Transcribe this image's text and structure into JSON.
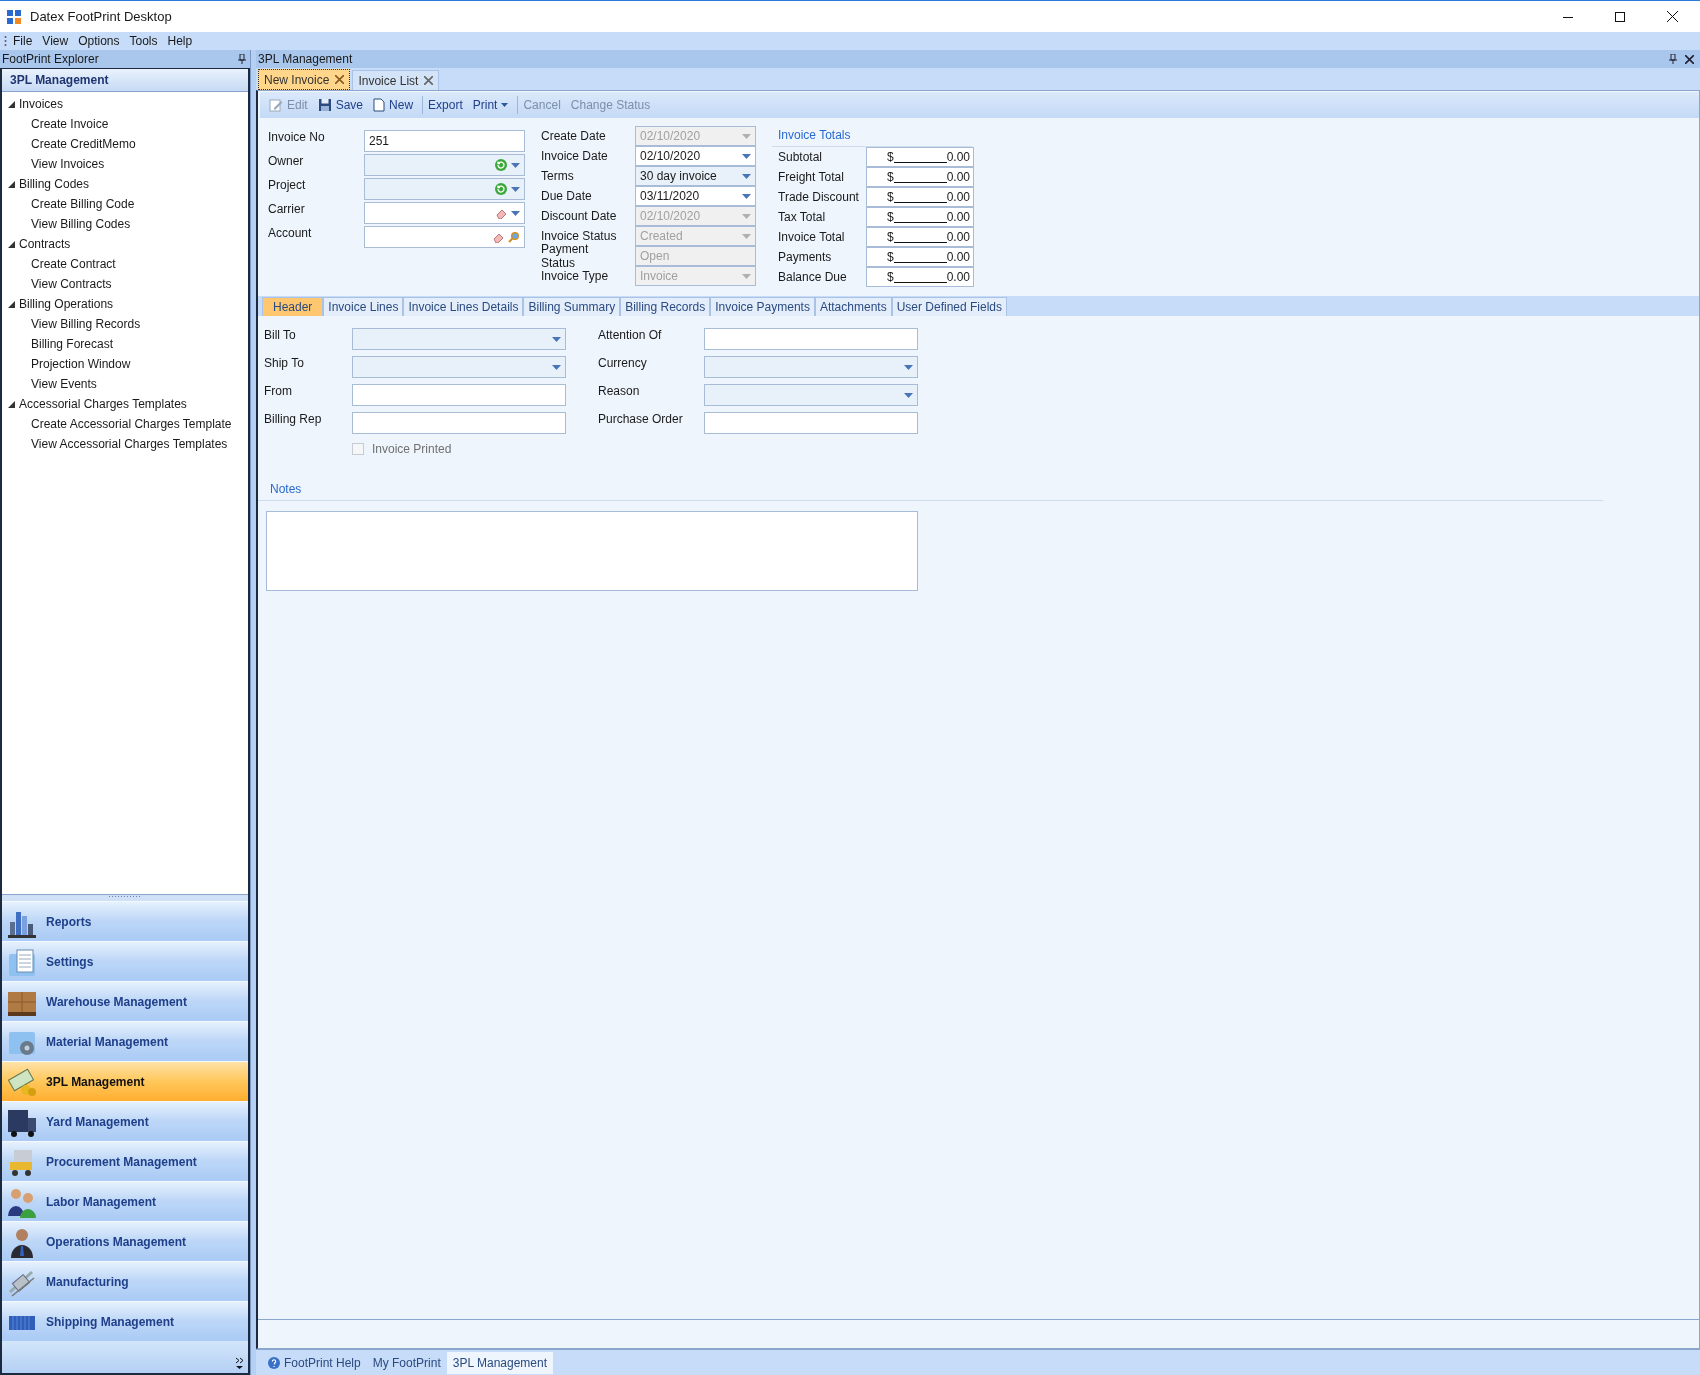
{
  "window": {
    "title": "Datex FootPrint Desktop"
  },
  "menu": [
    "File",
    "View",
    "Options",
    "Tools",
    "Help"
  ],
  "explorer": {
    "title": "FootPrint Explorer",
    "section": "3PL Management",
    "tree": [
      {
        "label": "Invoices",
        "expanded": true,
        "children": [
          {
            "label": "Create Invoice"
          },
          {
            "label": "Create CreditMemo"
          },
          {
            "label": "View Invoices"
          }
        ]
      },
      {
        "label": "Billing Codes",
        "expanded": true,
        "children": [
          {
            "label": "Create Billing Code"
          },
          {
            "label": "View Billing Codes"
          }
        ]
      },
      {
        "label": "Contracts",
        "expanded": true,
        "children": [
          {
            "label": "Create Contract"
          },
          {
            "label": "View Contracts"
          }
        ]
      },
      {
        "label": "Billing Operations",
        "expanded": true,
        "children": [
          {
            "label": "View Billing Records"
          },
          {
            "label": "Billing Forecast"
          },
          {
            "label": "Projection Window"
          },
          {
            "label": "View Events"
          }
        ]
      },
      {
        "label": "Accessorial Charges Templates",
        "expanded": true,
        "children": [
          {
            "label": "Create Accessorial Charges Template"
          },
          {
            "label": "View Accessorial Charges Templates"
          }
        ]
      }
    ],
    "modules": [
      {
        "label": "Reports",
        "kind": "chart",
        "selected": false
      },
      {
        "label": "Settings",
        "kind": "folder-doc",
        "selected": false
      },
      {
        "label": "Warehouse Management",
        "kind": "boxes",
        "selected": false
      },
      {
        "label": "Material Management",
        "kind": "folder-gear",
        "selected": false
      },
      {
        "label": "3PL Management",
        "kind": "money",
        "selected": true
      },
      {
        "label": "Yard Management",
        "kind": "truck",
        "selected": false
      },
      {
        "label": "Procurement Management",
        "kind": "cart",
        "selected": false
      },
      {
        "label": "Labor Management",
        "kind": "people",
        "selected": false
      },
      {
        "label": "Operations Management",
        "kind": "person",
        "selected": false
      },
      {
        "label": "Manufacturing",
        "kind": "machine",
        "selected": false
      },
      {
        "label": "Shipping Management",
        "kind": "container",
        "selected": false
      }
    ]
  },
  "workspace": {
    "title": "3PL Management",
    "doc_tabs": [
      {
        "label": "New Invoice",
        "selected": true
      },
      {
        "label": "Invoice List",
        "selected": false
      }
    ],
    "toolbar": [
      [
        {
          "label": "Edit",
          "kind": "edit",
          "disabled": true
        },
        {
          "label": "Save",
          "kind": "save",
          "disabled": false
        },
        {
          "label": "New",
          "kind": "new",
          "disabled": false
        }
      ],
      [
        {
          "label": "Export",
          "kind": "plain",
          "disabled": false
        },
        {
          "label": "Print",
          "kind": "menu",
          "disabled": false
        }
      ],
      [
        {
          "label": "Cancel",
          "kind": "plain",
          "disabled": true
        },
        {
          "label": "Change Status",
          "kind": "plain",
          "disabled": true
        }
      ]
    ],
    "fields_left": [
      {
        "label": "Invoice No",
        "kind": "text",
        "value": "251",
        "disabled": false
      },
      {
        "label": "Owner",
        "kind": "refresh-combo",
        "disabled": false
      },
      {
        "label": "Project",
        "kind": "refresh-combo",
        "disabled": false
      },
      {
        "label": "Carrier",
        "kind": "clear-combo",
        "disabled": false
      },
      {
        "label": "Account",
        "kind": "clear-search",
        "disabled": false
      }
    ],
    "fields_mid": [
      {
        "label": "Create Date",
        "kind": "date",
        "value": "02/10/2020",
        "disabled": true
      },
      {
        "label": "Invoice Date",
        "kind": "date",
        "value": "02/10/2020",
        "disabled": false
      },
      {
        "label": "Terms",
        "kind": "combo",
        "value": "30 day invoice",
        "disabled": false
      },
      {
        "label": "Due Date",
        "kind": "date",
        "value": "03/11/2020",
        "disabled": false
      },
      {
        "label": "Discount Date",
        "kind": "date",
        "value": "02/10/2020",
        "disabled": true
      },
      {
        "label": "Invoice Status",
        "kind": "combo",
        "value": "Created",
        "disabled": true
      },
      {
        "label": "Payment Status",
        "kind": "text",
        "value": "Open",
        "disabled": true
      },
      {
        "label": "Invoice Type",
        "kind": "combo",
        "value": "Invoice",
        "disabled": true
      }
    ],
    "totals": {
      "title": "Invoice Totals",
      "rows": [
        {
          "label": "Subtotal",
          "currency": "$",
          "amount": "0.00"
        },
        {
          "label": "Freight Total",
          "currency": "$",
          "amount": "0.00"
        },
        {
          "label": "Trade Discount",
          "currency": "$",
          "amount": "0.00"
        },
        {
          "label": "Tax Total",
          "currency": "$",
          "amount": "0.00"
        },
        {
          "label": "Invoice Total",
          "currency": "$",
          "amount": "0.00"
        },
        {
          "label": "Payments",
          "currency": "$",
          "amount": "0.00"
        },
        {
          "label": "Balance Due",
          "currency": "$",
          "amount": "0.00"
        }
      ]
    },
    "detail_tabs": [
      {
        "label": "Header",
        "selected": true
      },
      {
        "label": "Invoice Lines",
        "selected": false
      },
      {
        "label": "Invoice Lines Details",
        "selected": false
      },
      {
        "label": "Billing Summary",
        "selected": false
      },
      {
        "label": "Billing Records",
        "selected": false
      },
      {
        "label": "Invoice Payments",
        "selected": false
      },
      {
        "label": "Attachments",
        "selected": false
      },
      {
        "label": "User Defined Fields",
        "selected": false
      }
    ],
    "header_left": [
      {
        "label": "Bill To",
        "kind": "combo",
        "disabled": false
      },
      {
        "label": "Ship To",
        "kind": "combo",
        "disabled": false
      },
      {
        "label": "From",
        "kind": "text",
        "disabled": false
      },
      {
        "label": "Billing Rep",
        "kind": "text",
        "disabled": false
      }
    ],
    "header_right": [
      {
        "label": "Attention Of",
        "kind": "text",
        "disabled": false
      },
      {
        "label": "Currency",
        "kind": "combo",
        "disabled": false
      },
      {
        "label": "Reason",
        "kind": "combo",
        "disabled": false
      },
      {
        "label": "Purchase Order",
        "kind": "text",
        "disabled": false
      }
    ],
    "invoice_printed": {
      "label": "Invoice Printed",
      "checked": false,
      "disabled": true
    },
    "notes": {
      "title": "Notes"
    }
  },
  "status_tabs": [
    {
      "label": "FootPrint Help",
      "kind": "help",
      "selected": false
    },
    {
      "label": "My FootPrint",
      "kind": "plain",
      "selected": false
    },
    {
      "label": "3PL Management",
      "kind": "plain",
      "selected": true
    }
  ]
}
